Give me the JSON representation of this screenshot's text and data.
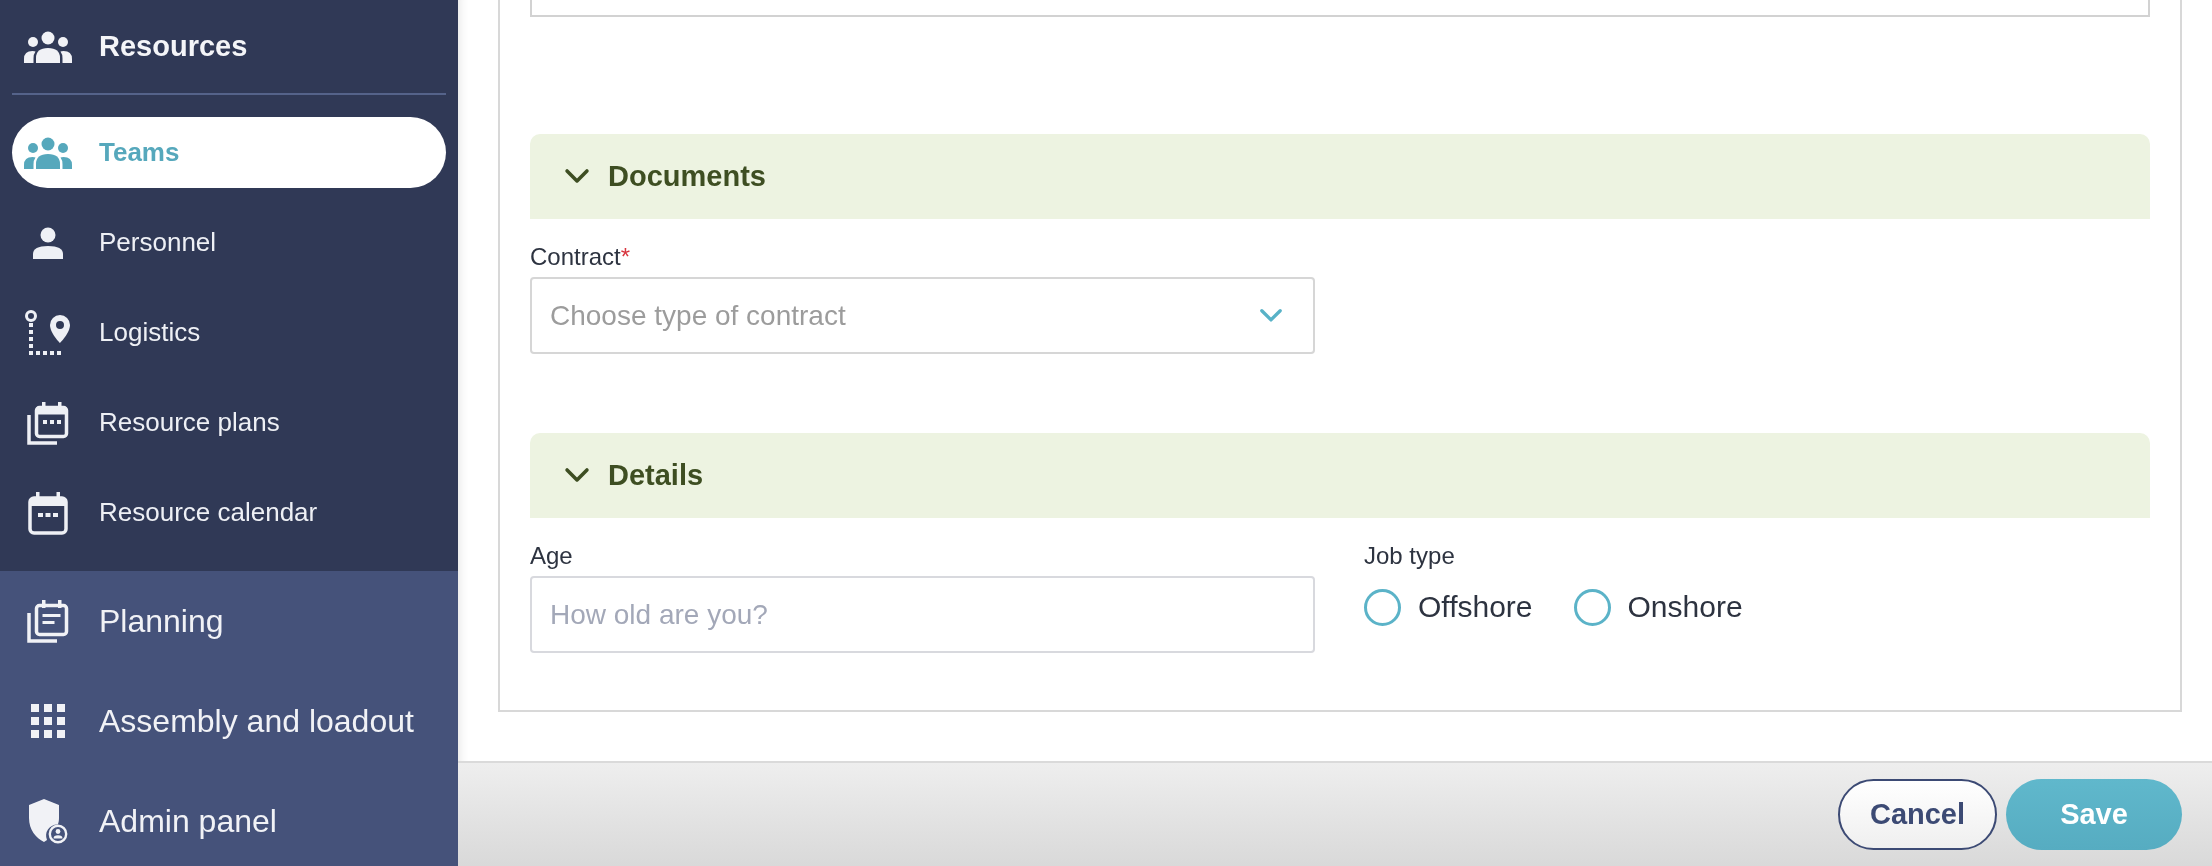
{
  "sidebar": {
    "group": {
      "title": "Resources",
      "items": [
        {
          "label": "Teams",
          "selected": true
        },
        {
          "label": "Personnel",
          "selected": false
        },
        {
          "label": "Logistics",
          "selected": false
        },
        {
          "label": "Resource plans",
          "selected": false
        },
        {
          "label": "Resource calendar",
          "selected": false
        }
      ]
    },
    "modules": [
      {
        "label": "Planning",
        "selected": false
      },
      {
        "label": "Assembly and loadout",
        "selected": false
      },
      {
        "label": "Admin panel",
        "selected": false
      }
    ]
  },
  "form": {
    "sections": [
      {
        "title": "Documents",
        "expanded": true,
        "fields": [
          {
            "kind": "select",
            "label": "Contract",
            "required_mark": "*",
            "placeholder": "Choose type of contract"
          }
        ]
      },
      {
        "title": "Details",
        "expanded": true,
        "fields": [
          {
            "kind": "text",
            "label": "Age",
            "placeholder": "How old are you?"
          },
          {
            "kind": "radio",
            "label": "Job type",
            "options": [
              {
                "label": "Offshore",
                "selected": false
              },
              {
                "label": "Onshore",
                "selected": false
              }
            ]
          }
        ]
      }
    ]
  },
  "footer": {
    "buttons": [
      {
        "label": "Cancel",
        "kind": "secondary"
      },
      {
        "label": "Save",
        "kind": "primary"
      }
    ]
  }
}
